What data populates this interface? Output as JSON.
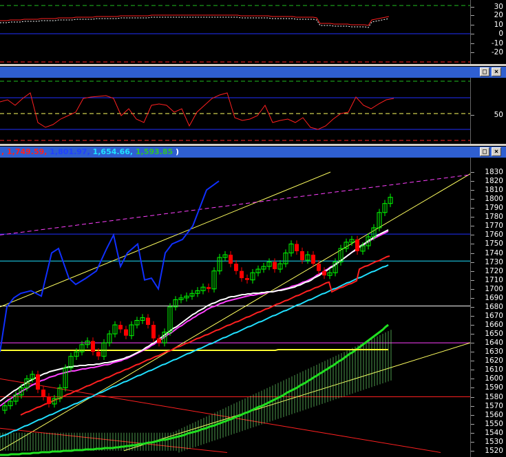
{
  "panel1": {
    "axis_ticks": [
      "30",
      "20",
      "10",
      "0",
      "-10",
      "-20"
    ]
  },
  "panel2": {
    "axis_ticks": [
      "50"
    ],
    "buttons": [
      "□",
      "×"
    ]
  },
  "panel3": {
    "legend": [
      {
        "text": ", 1,749.59,",
        "color": "#ff2020"
      },
      {
        "text": " 1,801.97,",
        "color": "#2040ff"
      },
      {
        "text": " 1,654.66,",
        "color": "#20e0ff"
      },
      {
        "text": " 1,593.85",
        "color": "#30c030"
      },
      {
        "text": " )",
        "color": "#ffffff"
      }
    ],
    "buttons": [
      "□",
      "×"
    ],
    "axis_ticks": [
      "1830",
      "1820",
      "1810",
      "1800",
      "1790",
      "1780",
      "1770",
      "1760",
      "1750",
      "1740",
      "1730",
      "1720",
      "1710",
      "1700",
      "1690",
      "1680",
      "1670",
      "1660",
      "1650",
      "1640",
      "1630",
      "1620",
      "1610",
      "1600",
      "1590",
      "1580",
      "1570",
      "1560",
      "1550",
      "1540",
      "1530",
      "1520"
    ]
  },
  "colors": {
    "titlebar": "#2f5fd0",
    "candle_up": "#00ff00",
    "candle_down": "#ff0000",
    "ma_white": "#ffffff",
    "ma_magenta": "#ff40ff",
    "ma_red": "#ff0000",
    "ma_cyan": "#20e0ff",
    "ma_green": "#20e020",
    "cloud": "#80ff80",
    "lagging_blue": "#1030ff"
  },
  "chart_data": {
    "type": "candlestick",
    "y_unit": "price",
    "ylim": [
      1516,
      1837
    ],
    "closes": [
      1570,
      1575,
      1582,
      1590,
      1600,
      1605,
      1588,
      1580,
      1572,
      1578,
      1590,
      1612,
      1625,
      1630,
      1638,
      1642,
      1630,
      1625,
      1640,
      1650,
      1660,
      1655,
      1648,
      1660,
      1665,
      1668,
      1660,
      1645,
      1640,
      1652,
      1680,
      1688,
      1690,
      1692,
      1695,
      1698,
      1702,
      1700,
      1720,
      1735,
      1738,
      1728,
      1720,
      1712,
      1710,
      1718,
      1722,
      1725,
      1730,
      1722,
      1728,
      1740,
      1750,
      1742,
      1732,
      1738,
      1728,
      1720,
      1715,
      1718,
      1730,
      1745,
      1752,
      1755,
      1742,
      1748,
      1758,
      1768,
      1785,
      1795,
      1802
    ]
  }
}
